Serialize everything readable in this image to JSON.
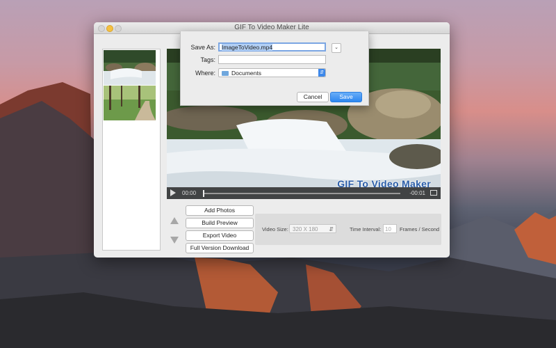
{
  "window": {
    "title": "GIF To Video Maker Lite"
  },
  "player": {
    "current_time": "00:00",
    "remaining_time": "-00:01",
    "watermark": "GIF To Video Maker"
  },
  "actions": {
    "add_photos": "Add Photos",
    "build_preview": "Build Preview",
    "export_video": "Export Video",
    "full_version": "Full Version Download"
  },
  "settings": {
    "video_size_label": "Video Size:",
    "video_size_value": "320 X 180",
    "time_interval_label": "Time Interval:",
    "time_interval_value": "10",
    "time_interval_unit": "Frames / Second"
  },
  "save_dialog": {
    "save_as_label": "Save As:",
    "save_as_value": "ImageToVideo.mp4",
    "tags_label": "Tags:",
    "tags_value": "",
    "where_label": "Where:",
    "where_value": "Documents",
    "cancel_label": "Cancel",
    "save_label": "Save"
  },
  "colors": {
    "accent": "#2d86f0",
    "traffic_minimize": "#f5c142"
  }
}
